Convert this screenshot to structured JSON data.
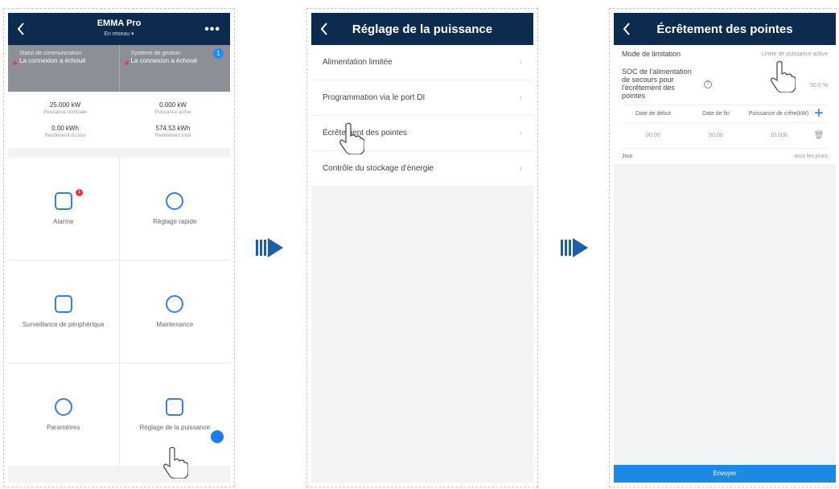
{
  "screen1": {
    "header": {
      "title": "EMMA Pro",
      "subtitle": "En réseau ▾",
      "more": "•••"
    },
    "status": [
      {
        "title": "Statut de communication",
        "value": "La connexion a échoué"
      },
      {
        "title": "Système de gestion",
        "value": "La connexion a échoué",
        "badge": "1"
      }
    ],
    "stats": [
      {
        "value": "25.000 kW",
        "label": "Puissance nominale"
      },
      {
        "value": "0.000 kW",
        "label": "Puissance active"
      },
      {
        "value": "0.00 kWh",
        "label": "Rendement du jour"
      },
      {
        "value": "574.53 kWh",
        "label": "Rendement total"
      }
    ],
    "tiles": [
      {
        "label": "Alarme",
        "icon": "alarm-icon",
        "badge": "1"
      },
      {
        "label": "Réglage rapide",
        "icon": "quick-setting-icon"
      },
      {
        "label": "Surveillance de périphérique",
        "icon": "monitor-icon"
      },
      {
        "label": "Maintenance",
        "icon": "maintenance-icon"
      },
      {
        "label": "Paramètres",
        "icon": "gear-icon"
      },
      {
        "label": "Réglage de la puissance",
        "icon": "power-setting-icon"
      }
    ]
  },
  "screen2": {
    "header": {
      "title": "Réglage de la puissance"
    },
    "items": [
      "Alimentation limitée",
      "Programmation via le port DI",
      "Écrêtement des pointes",
      "Contrôle du stockage d'énergie"
    ]
  },
  "screen3": {
    "header": {
      "title": "Écrêtement des pointes"
    },
    "mode_label": "Mode de limitation",
    "mode_value": "Limite de puissance active",
    "soc_label": "SOC de l'alimentation de secours pour l'écrêtement des pointes",
    "soc_value": "50.0 %",
    "columns": [
      "Date de début",
      "Date de fin",
      "Puissance de crête(kW)"
    ],
    "row": [
      "00:00",
      "00:00",
      "10.000"
    ],
    "day_label": "Jour",
    "day_value": "tous les jours",
    "submit": "Envoyer"
  },
  "colors": {
    "header": "#0d2a4f",
    "accent": "#1e88e5",
    "arrow": "#1a5fa8"
  }
}
